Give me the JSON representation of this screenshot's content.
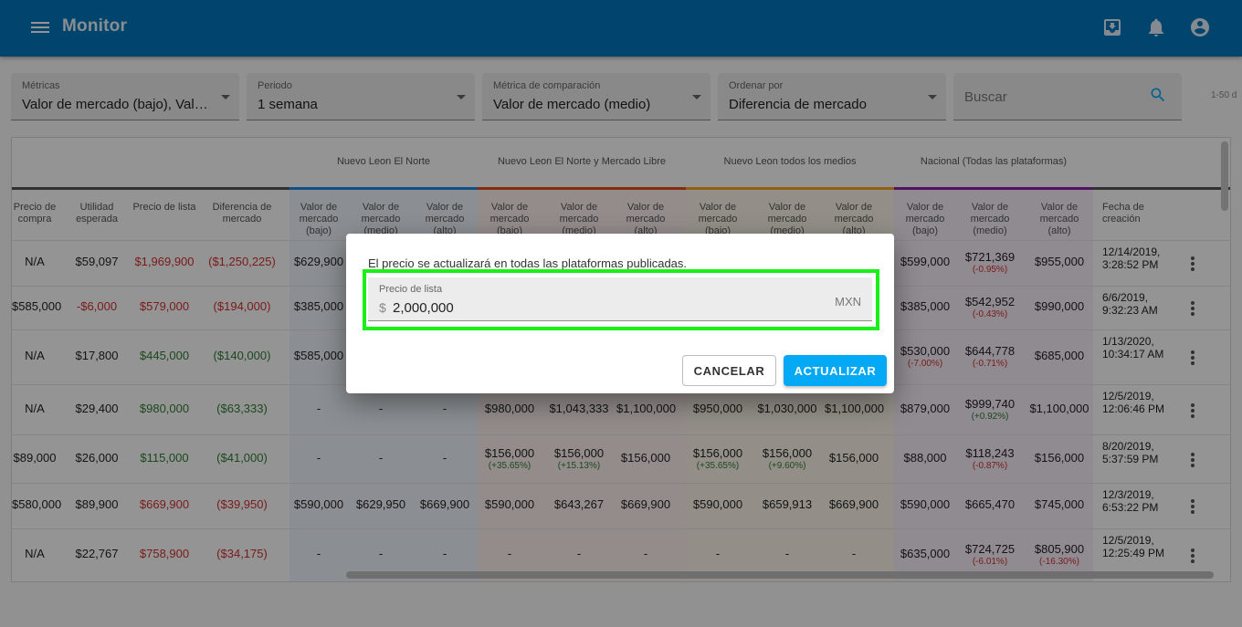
{
  "app": {
    "title": "Monitor"
  },
  "filters": [
    {
      "label": "Métricas",
      "value": "Valor de mercado (bajo), Valor de mercado (medio)"
    },
    {
      "label": "Periodo",
      "value": "1 semana"
    },
    {
      "label": "Métrica de comparación",
      "value": "Valor de mercado (medio)"
    },
    {
      "label": "Ordenar por",
      "value": "Diferencia de mercado"
    }
  ],
  "search": {
    "placeholder": "Buscar"
  },
  "paging": "1-50 d",
  "groups": [
    {
      "label": "Nuevo Leon El Norte",
      "color": "#1e88e5"
    },
    {
      "label": "Nuevo Leon El Norte y Mercado Libre",
      "color": "#e64a19"
    },
    {
      "label": "Nuevo Leon todos los medios",
      "color": "#f9a825"
    },
    {
      "label": "Nacional (Todas las plataformas)",
      "color": "#8e24aa"
    }
  ],
  "columns": [
    "Precio de compra",
    "Utilidad esperada",
    "Precio de lista",
    "Diferencia de mercado",
    "Valor de mercado (bajo)",
    "Valor de mercado (medio)",
    "Valor de mercado (alto)",
    "Valor de mercado (bajo)",
    "Valor de mercado (medio)",
    "Valor de mercado (alto)",
    "Valor de mercado (bajo)",
    "Valor de mercado (medio)",
    "Valor de mercado (alto)",
    "Valor de mercado (bajo)",
    "Valor de mercado (medio)",
    "Valor de mercado (alto)",
    "Fecha de creación"
  ],
  "rows": [
    {
      "cells": [
        "N/A",
        "$59,097",
        "$1,969,900",
        "($1,250,225)",
        "$629,900",
        "",
        "",
        "",
        "",
        "",
        "",
        "",
        "",
        "$599,000",
        "$721,369",
        "$955,000",
        "12/14/2019, 3:28:52 PM"
      ],
      "subs": {
        "14": "(-0.95%)"
      },
      "colors": {
        "2": "red",
        "3": "red"
      }
    },
    {
      "cells": [
        "$585,000",
        "-$6,000",
        "$579,000",
        "($194,000)",
        "$385,000",
        "",
        "",
        "",
        "",
        "",
        "",
        "",
        "",
        "$385,000",
        "$542,952",
        "$990,000",
        "6/6/2019, 9:32:23 AM"
      ],
      "subs": {
        "14": "(-0.43%)"
      },
      "colors": {
        "1": "red",
        "2": "red",
        "3": "red"
      }
    },
    {
      "cells": [
        "N/A",
        "$17,800",
        "$445,000",
        "($140,000)",
        "$585,000",
        "",
        "",
        "",
        "",
        "",
        "",
        "",
        "",
        "$530,000",
        "$644,778",
        "$685,000",
        "1/13/2020, 10:34:17 AM"
      ],
      "subs": {
        "13": "(-7.00%)",
        "14": "(-0.71%)"
      },
      "colors": {
        "2": "green",
        "3": "green"
      }
    },
    {
      "cells": [
        "N/A",
        "$29,400",
        "$980,000",
        "($63,333)",
        "-",
        "-",
        "-",
        "$980,000",
        "$1,043,333",
        "$1,100,000",
        "$950,000",
        "$1,030,000",
        "$1,100,000",
        "$879,000",
        "$999,740",
        "$1,100,000",
        "12/5/2019, 12:06:46 PM"
      ],
      "subs": {
        "14": "(+0.92%)"
      },
      "colors": {
        "2": "green",
        "3": "green"
      }
    },
    {
      "cells": [
        "$89,000",
        "$26,000",
        "$115,000",
        "($41,000)",
        "-",
        "-",
        "-",
        "$156,000",
        "$156,000",
        "$156,000",
        "$156,000",
        "$156,000",
        "$156,000",
        "$88,000",
        "$118,243",
        "$156,000",
        "8/20/2019, 5:37:59 PM"
      ],
      "subs": {
        "7": "(+35.65%)",
        "8": "(+15.13%)",
        "10": "(+35.65%)",
        "11": "(+9.60%)",
        "14": "(-0.87%)"
      },
      "colors": {
        "2": "green",
        "3": "green"
      }
    },
    {
      "cells": [
        "$580,000",
        "$89,900",
        "$669,900",
        "($39,950)",
        "$590,000",
        "$629,950",
        "$669,900",
        "$590,000",
        "$643,267",
        "$669,900",
        "$590,000",
        "$659,913",
        "$669,900",
        "$590,000",
        "$665,470",
        "$745,000",
        "12/3/2019, 6:53:22 PM"
      ],
      "subs": {},
      "colors": {
        "2": "red",
        "3": "red"
      }
    },
    {
      "cells": [
        "N/A",
        "$22,767",
        "$758,900",
        "($34,175)",
        "-",
        "-",
        "-",
        "-",
        "-",
        "-",
        "-",
        "-",
        "-",
        "$635,000",
        "$724,725",
        "$805,900",
        "12/5/2019, 12:25:49 PM"
      ],
      "subs": {
        "14": "(-6.01%)",
        "15": "(-16.30%)"
      },
      "colors": {
        "2": "red",
        "3": "red"
      }
    }
  ],
  "dialog": {
    "message": "El precio se actualizará en todas las plataformas publicadas.",
    "field_label": "Precio de lista",
    "prefix": "$",
    "value": "2,000,000",
    "suffix": "MXN",
    "cancel_label": "CANCELAR",
    "confirm_label": "ACTUALIZAR",
    "highlight_color": "#18f018"
  }
}
